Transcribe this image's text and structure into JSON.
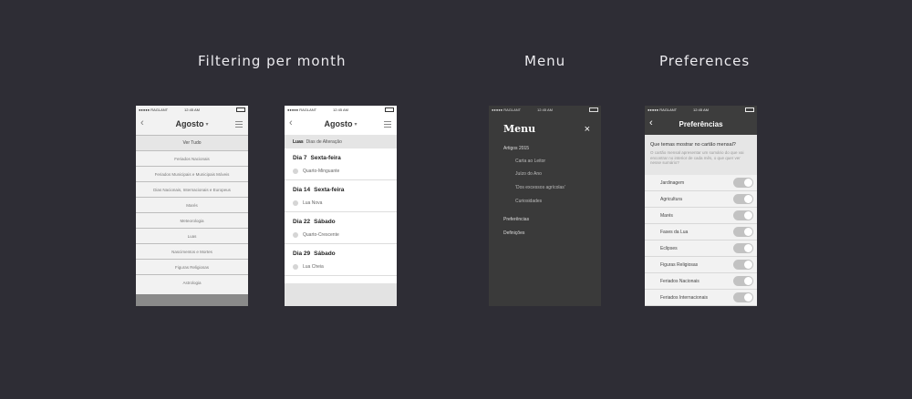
{
  "sections": {
    "filtering": "Filtering per month",
    "menu": "Menu",
    "preferences": "Preferences"
  },
  "status": {
    "carrier": "●●●●● RAGLANT",
    "time": "12:45 AM"
  },
  "month_screen": {
    "title": "Agosto",
    "items": [
      "Ver Tudo",
      "Feriados Nacionais",
      "Feriados Municipais e Municipais Móveis",
      "Dias Nacionais, Internacionais e Europeus",
      "Marés",
      "Meteorologia",
      "Luas",
      "Nascimentos e Mortes",
      "Figuras Religiosas",
      "Astrologia"
    ]
  },
  "moon_screen": {
    "title": "Agosto",
    "filter_label": "Luas",
    "filter_sub": "Dias de Alteração",
    "entries": [
      {
        "day": "Dia 7",
        "weekday": "Sexta-feira",
        "phase": "Quarto-Minguante"
      },
      {
        "day": "Dia 14",
        "weekday": "Sexta-feira",
        "phase": "Lua Nova"
      },
      {
        "day": "Dia 22",
        "weekday": "Sábado",
        "phase": "Quarto-Crescente"
      },
      {
        "day": "Dia 29",
        "weekday": "Sábado",
        "phase": "Lua Cheia"
      }
    ]
  },
  "menu_screen": {
    "title": "Menu",
    "close": "×",
    "items": [
      {
        "label": "Artigos 2015",
        "sub": false
      },
      {
        "label": "Carta ao Leitor",
        "sub": true
      },
      {
        "label": "Juízo do Ano",
        "sub": true
      },
      {
        "label": "'Dos excessos agrícolas'",
        "sub": true
      },
      {
        "label": "Curiosidades",
        "sub": true
      },
      {
        "label": "Preferências",
        "sub": false
      },
      {
        "label": "Definições",
        "sub": false
      }
    ]
  },
  "pref_screen": {
    "title": "Preferências",
    "question": "Que temas mostrar no cartão mensal?",
    "description": "O cartão mensal apresentar um sumário do que vai encontrar no interior de cada mês, o que quer ver nesse sumário?",
    "options": [
      "Jardinagem",
      "Agricultura",
      "Marés",
      "Fases da Lua",
      "Eclipses",
      "Figuras Religiosas",
      "Feriados Nacionais",
      "Feriados Internacionais"
    ]
  }
}
